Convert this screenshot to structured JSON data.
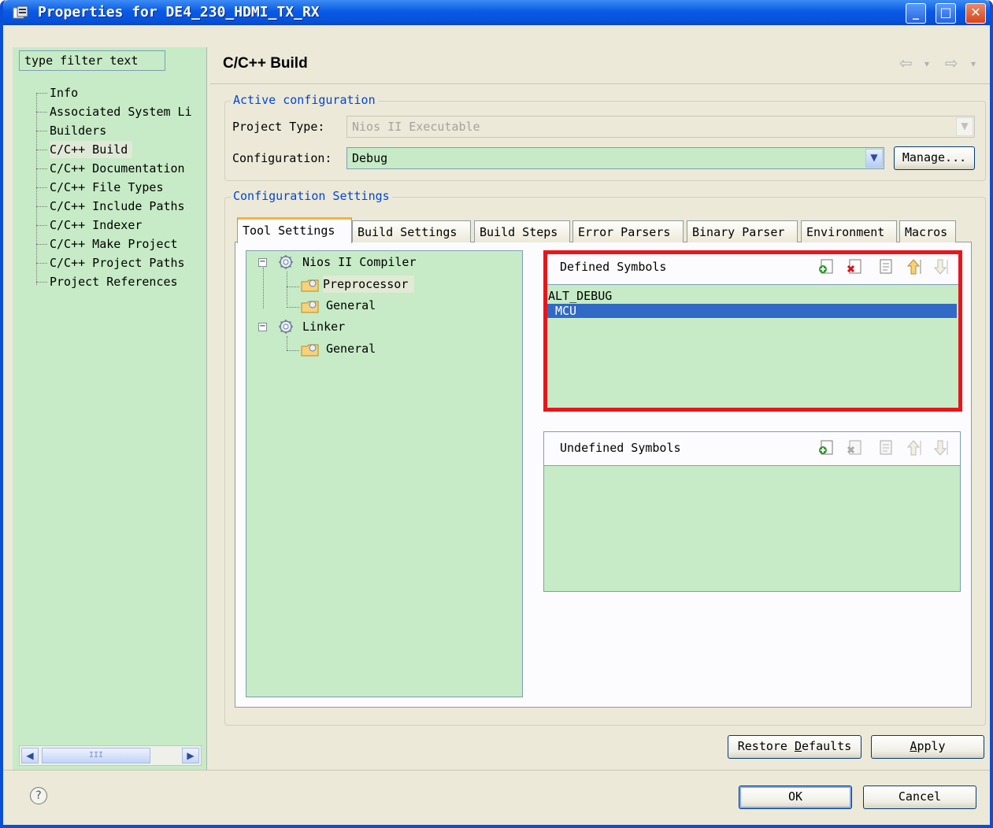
{
  "window": {
    "title": "Properties for DE4_230_HDMI_TX_RX"
  },
  "titlebar_buttons": {
    "minimize": "_",
    "maximize": "□",
    "close": "✕"
  },
  "sidebar": {
    "filter_placeholder": "type filter text",
    "items": [
      {
        "label": "Info"
      },
      {
        "label": "Associated System Li"
      },
      {
        "label": "Builders"
      },
      {
        "label": "C/C++ Build",
        "selected": true
      },
      {
        "label": "C/C++ Documentation"
      },
      {
        "label": "C/C++ File Types"
      },
      {
        "label": "C/C++ Include Paths"
      },
      {
        "label": "C/C++ Indexer"
      },
      {
        "label": "C/C++ Make Project"
      },
      {
        "label": "C/C++ Project Paths"
      },
      {
        "label": "Project References"
      }
    ],
    "scroll_thumb_glyph": "III"
  },
  "page": {
    "title": "C/C++ Build",
    "back_arrow": "⇦",
    "forward_arrow": "⇨",
    "dropdown_glyph": "▾"
  },
  "active_configuration": {
    "group_title": "Active configuration",
    "project_type_label": "Project Type:",
    "project_type_value": "Nios II Executable",
    "configuration_label": "Configuration:",
    "configuration_value": "Debug",
    "manage_button": "Manage..."
  },
  "configuration_settings": {
    "group_title": "Configuration Settings",
    "tabs": [
      {
        "label": "Tool Settings",
        "active": true
      },
      {
        "label": "Build Settings"
      },
      {
        "label": "Build Steps"
      },
      {
        "label": "Error Parsers"
      },
      {
        "label": "Binary Parser"
      },
      {
        "label": "Environment"
      },
      {
        "label": "Macros"
      }
    ]
  },
  "tool_tree": {
    "nodes": [
      {
        "label": "Nios II Compiler",
        "expander": "−"
      },
      {
        "label": "Preprocessor",
        "selected": true
      },
      {
        "label": "General"
      },
      {
        "label": "Linker",
        "expander": "−"
      },
      {
        "label": "General"
      }
    ]
  },
  "defined_symbols": {
    "title": "Defined Symbols",
    "items": [
      {
        "value": "ALT_DEBUG"
      },
      {
        "value": "MCU",
        "selected": true
      }
    ]
  },
  "undefined_symbols": {
    "title": "Undefined Symbols",
    "items": []
  },
  "toolbar_icons": [
    "add-icon",
    "delete-icon",
    "edit-icon",
    "move-up-icon",
    "move-down-icon"
  ],
  "buttons": {
    "restore_defaults_pre": "Restore ",
    "restore_defaults_u": "D",
    "restore_defaults_post": "efaults",
    "apply_u": "A",
    "apply_post": "pply",
    "ok": "OK",
    "cancel": "Cancel"
  },
  "help_glyph": "?",
  "colors": {
    "title_bar": "#0a5ae6",
    "list_background": "#c6ebc6",
    "selection": "#316ac5",
    "highlight_box": "#e8161b",
    "group_title": "#0046d5"
  }
}
